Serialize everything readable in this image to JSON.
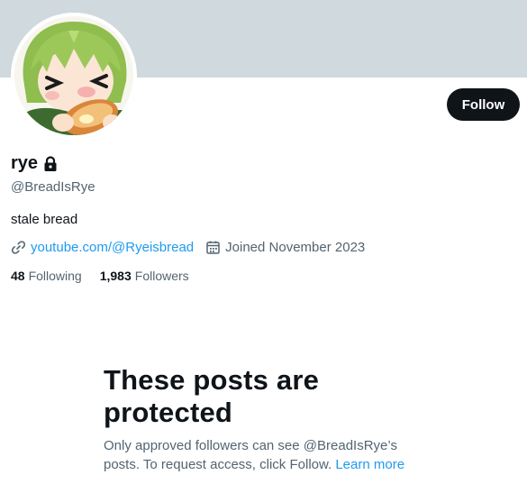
{
  "profile": {
    "display_name": "rye",
    "handle": "@BreadIsRye",
    "bio": "stale bread",
    "link": "youtube.com/@Ryeisbread",
    "joined": "Joined November 2023",
    "following_count": "48",
    "following_label": "Following",
    "followers_count": "1,983",
    "followers_label": "Followers"
  },
  "actions": {
    "follow_label": "Follow"
  },
  "protected": {
    "title": "These posts are protected",
    "body": "Only approved followers can see @BreadIsRye’s posts. To request access, click Follow.",
    "learn_more": "Learn more"
  },
  "icons": {
    "lock": "lock-icon",
    "link": "link-icon",
    "calendar": "calendar-icon"
  },
  "colors": {
    "banner": "#cfd9de",
    "accent": "#1d9bf0",
    "text_primary": "#0f1419",
    "text_secondary": "#536471",
    "button": "#0f1419"
  }
}
